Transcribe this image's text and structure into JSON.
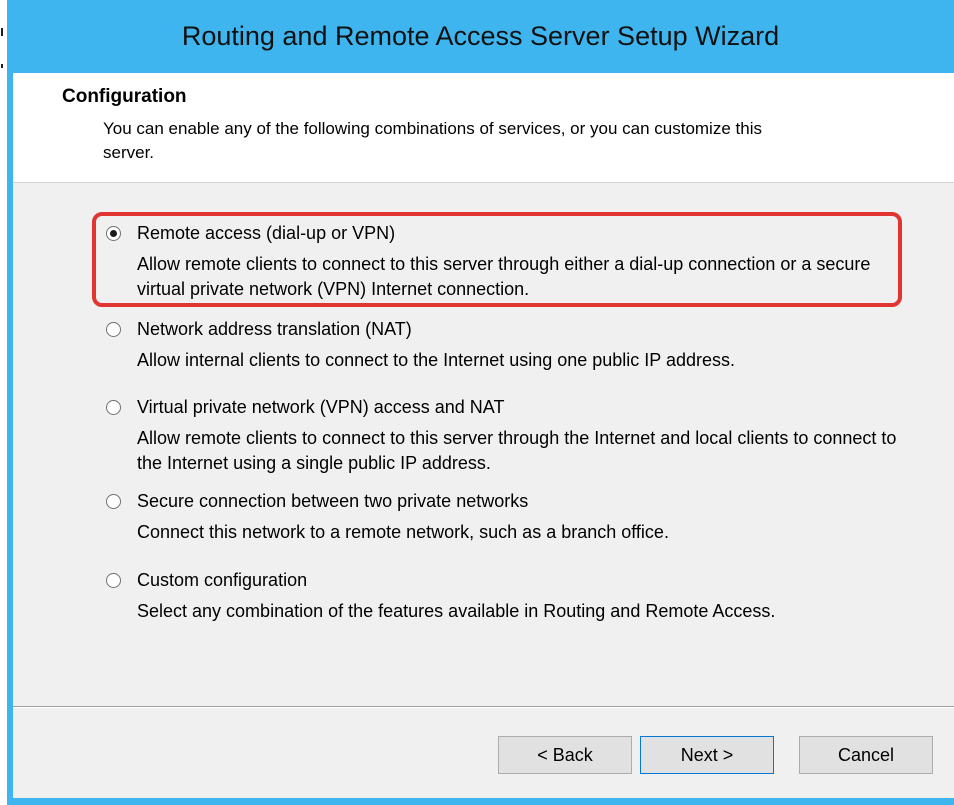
{
  "window": {
    "title": "Routing and Remote Access Server Setup Wizard"
  },
  "header": {
    "title": "Configuration",
    "description": "You can enable any of the following combinations of services, or you can customize this server."
  },
  "options": [
    {
      "label": "Remote access (dial-up or VPN)",
      "description": "Allow remote clients to connect to this server through either a dial-up connection or a secure virtual private network (VPN) Internet connection.",
      "selected": true
    },
    {
      "label": "Network address translation (NAT)",
      "description": "Allow internal clients to connect to the Internet using one public IP address.",
      "selected": false
    },
    {
      "label": "Virtual private network (VPN) access and NAT",
      "description": "Allow remote clients to connect to this server through the Internet and local clients to connect to the Internet using a single public IP address.",
      "selected": false
    },
    {
      "label": "Secure connection between two private networks",
      "description": "Connect this network to a remote network, such as a branch office.",
      "selected": false
    },
    {
      "label": "Custom configuration",
      "description": "Select any combination of the features available in Routing and Remote Access.",
      "selected": false
    }
  ],
  "buttons": {
    "back": "< Back",
    "next": "Next >",
    "cancel": "Cancel"
  },
  "colors": {
    "titlebar": "#3fb5ef",
    "highlight": "#e03530"
  }
}
